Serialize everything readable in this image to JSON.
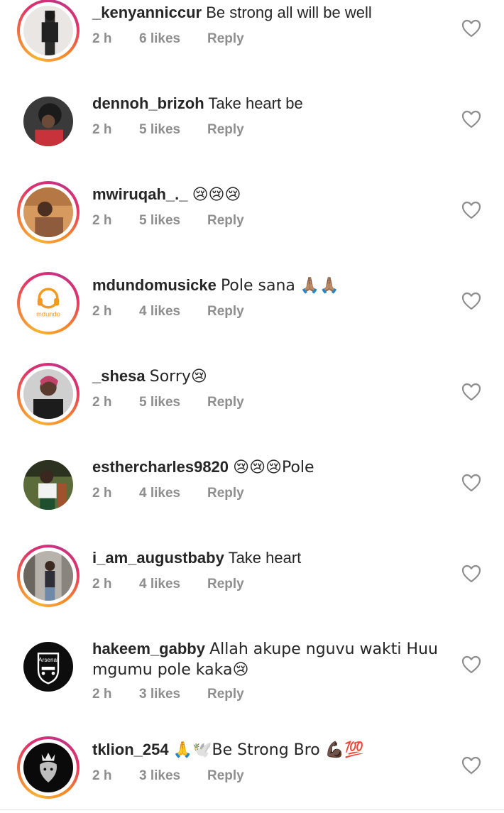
{
  "comments": [
    {
      "username": "_kenyanniccur",
      "text": "Be strong all will be well",
      "time": "2 h",
      "likes": "6 likes",
      "reply": "Reply",
      "story_ring": true,
      "avatar": "person-dark-photo"
    },
    {
      "username": "dennoh_brizoh",
      "text": "Take heart be",
      "time": "2 h",
      "likes": "5 likes",
      "reply": "Reply",
      "story_ring": false,
      "avatar": "person-red-shirt-photo"
    },
    {
      "username": "mwiruqah_._",
      "text": "😢😢😢",
      "time": "2 h",
      "likes": "5 likes",
      "reply": "Reply",
      "story_ring": true,
      "avatar": "person-warm-light-photo"
    },
    {
      "username": "mdundomusicke",
      "text": "Pole sana 🙏🏽🙏🏽",
      "time": "2 h",
      "likes": "4 likes",
      "reply": "Reply",
      "story_ring": true,
      "avatar": "mdundo-logo",
      "avatar_label": "mdundo"
    },
    {
      "username": "_shesa",
      "text": "Sorry😢",
      "time": "2 h",
      "likes": "5 likes",
      "reply": "Reply",
      "story_ring": true,
      "avatar": "person-pink-hair-photo"
    },
    {
      "username": "esthercharles9820",
      "text": "😢😢😢Pole",
      "time": "2 h",
      "likes": "4 likes",
      "reply": "Reply",
      "story_ring": false,
      "avatar": "person-outdoor-photo"
    },
    {
      "username": "i_am_augustbaby",
      "text": "Take heart",
      "time": "2 h",
      "likes": "4 likes",
      "reply": "Reply",
      "story_ring": true,
      "avatar": "person-indoor-photo"
    },
    {
      "username": "hakeem_gabby",
      "text": "Allah akupe nguvu wakti Huu mgumu pole kaka😢",
      "time": "2 h",
      "likes": "3 likes",
      "reply": "Reply",
      "story_ring": false,
      "avatar": "arsenal-crest",
      "avatar_label": "Arsenal"
    },
    {
      "username": "tklion_254",
      "text": "🙏🕊️Be Strong Bro 💪🏿💯",
      "time": "2 h",
      "likes": "3 likes",
      "reply": "Reply",
      "story_ring": true,
      "avatar": "lion-crown-logo"
    }
  ],
  "icons": {
    "like": "heart-outline-icon"
  },
  "colors": {
    "text": "#262626",
    "meta": "#8e8e8e",
    "heart_stroke": "#8e8e8e",
    "story_ring": "#e1306c"
  }
}
